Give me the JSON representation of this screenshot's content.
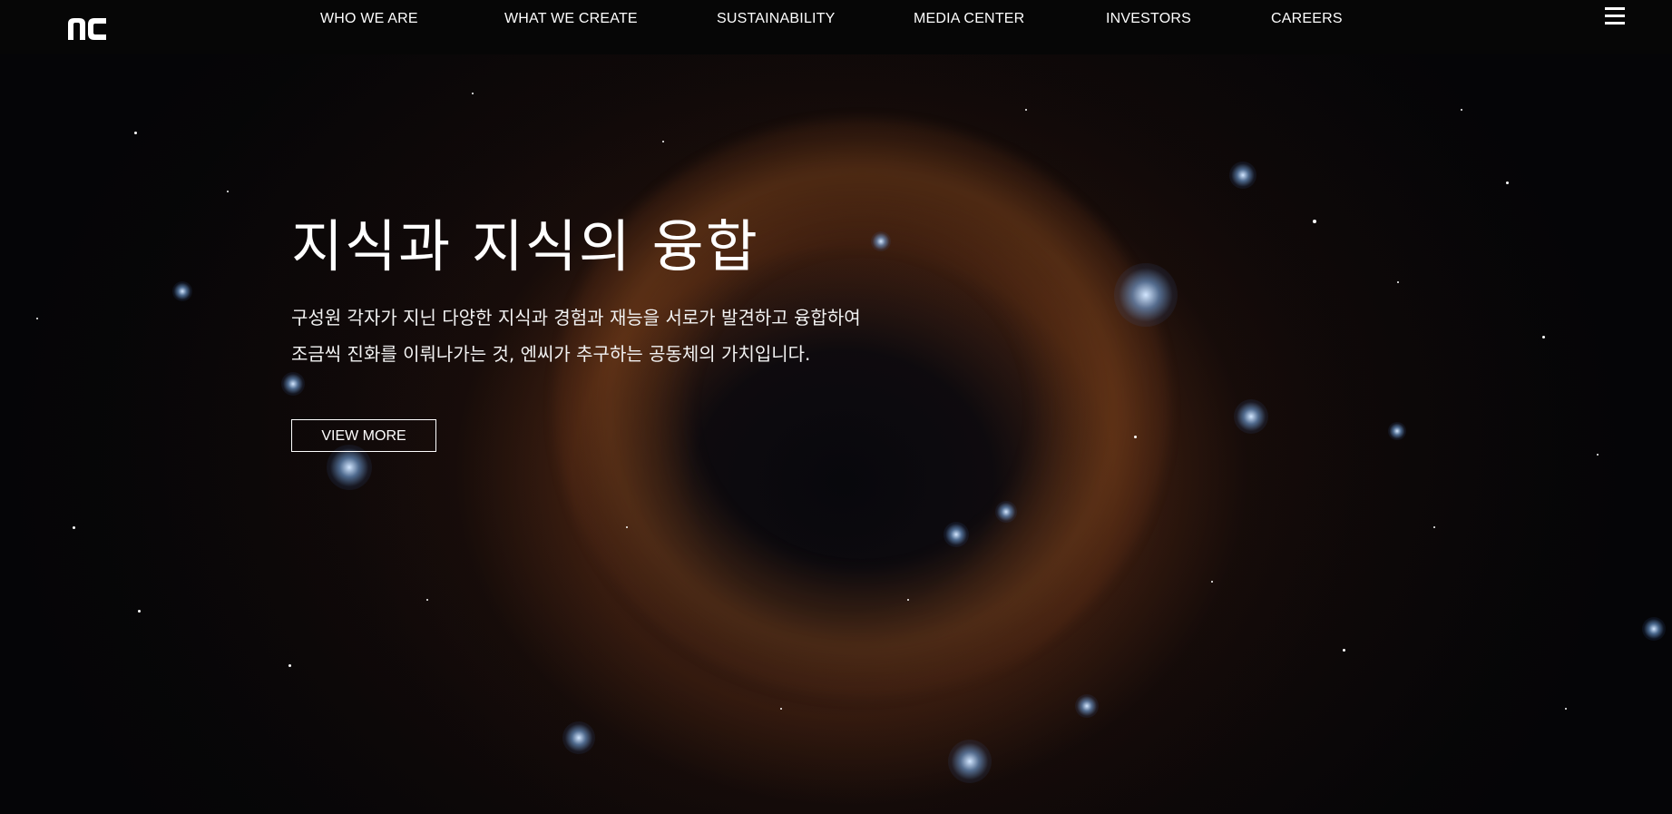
{
  "header": {
    "logo_icon": "nc-logo",
    "nav": [
      "WHO WE ARE",
      "WHAT WE CREATE",
      "SUSTAINABILITY",
      "MEDIA CENTER",
      "INVESTORS",
      "CAREERS"
    ],
    "menu_icon": "hamburger-menu-icon"
  },
  "hero": {
    "title": "지식과 지식의 융합",
    "description_line1": "구성원 각자가 지닌 다양한 지식과 경험과 재능을 서로가 발견하고 융합하여",
    "description_line2": "조금씩 진화를 이뤄나가는 것, 엔씨가 추구하는 공동체의 가치입니다.",
    "button_label": "VIEW MORE"
  },
  "colors": {
    "background": "#050507",
    "topbar": "#060606",
    "text": "#ffffff",
    "nebula_accent": "#b8692a"
  }
}
